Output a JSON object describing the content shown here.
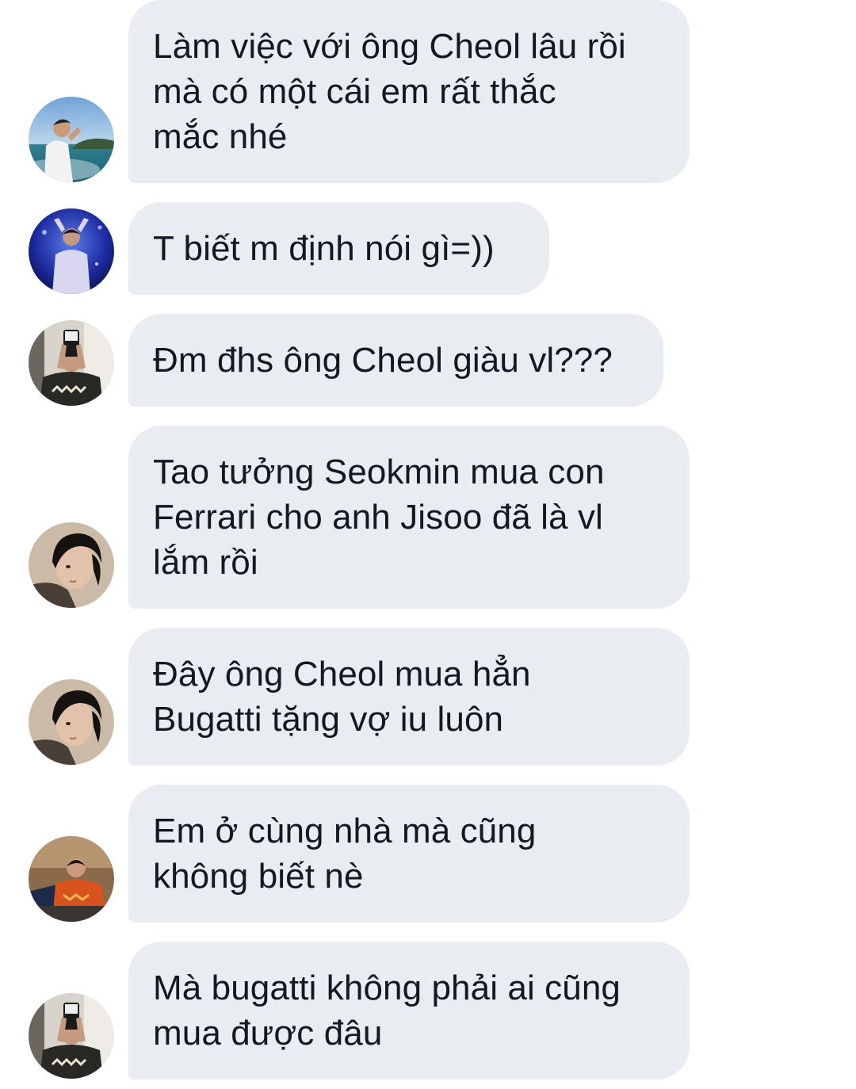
{
  "messages": [
    {
      "text": "Làm việc với ông Cheol lâu rồi\nmà có một cái em rất thắc\nmắc nhé",
      "avatar": "avatar-icon"
    },
    {
      "text": "T biết m định nói gì=))",
      "avatar": "avatar-icon"
    },
    {
      "text": "Đm đhs ông Cheol giàu vl???",
      "avatar": "avatar-icon"
    },
    {
      "text": "Tao tưởng Seokmin mua con\nFerrari cho anh Jisoo đã là vl\nlắm rồi",
      "avatar": "avatar-icon"
    },
    {
      "text": "Đây ông Cheol mua hẳn\nBugatti tặng vợ iu luôn",
      "avatar": "avatar-icon"
    },
    {
      "text": "Em ở cùng nhà mà cũng\nkhông biết nè",
      "avatar": "avatar-icon"
    },
    {
      "text": "Mà bugatti không phải ai cũng\nmua được đâu",
      "avatar": "avatar-icon"
    }
  ],
  "colors": {
    "bubble": "#e9ecf1",
    "text": "#141823",
    "background": "#ffffff"
  }
}
